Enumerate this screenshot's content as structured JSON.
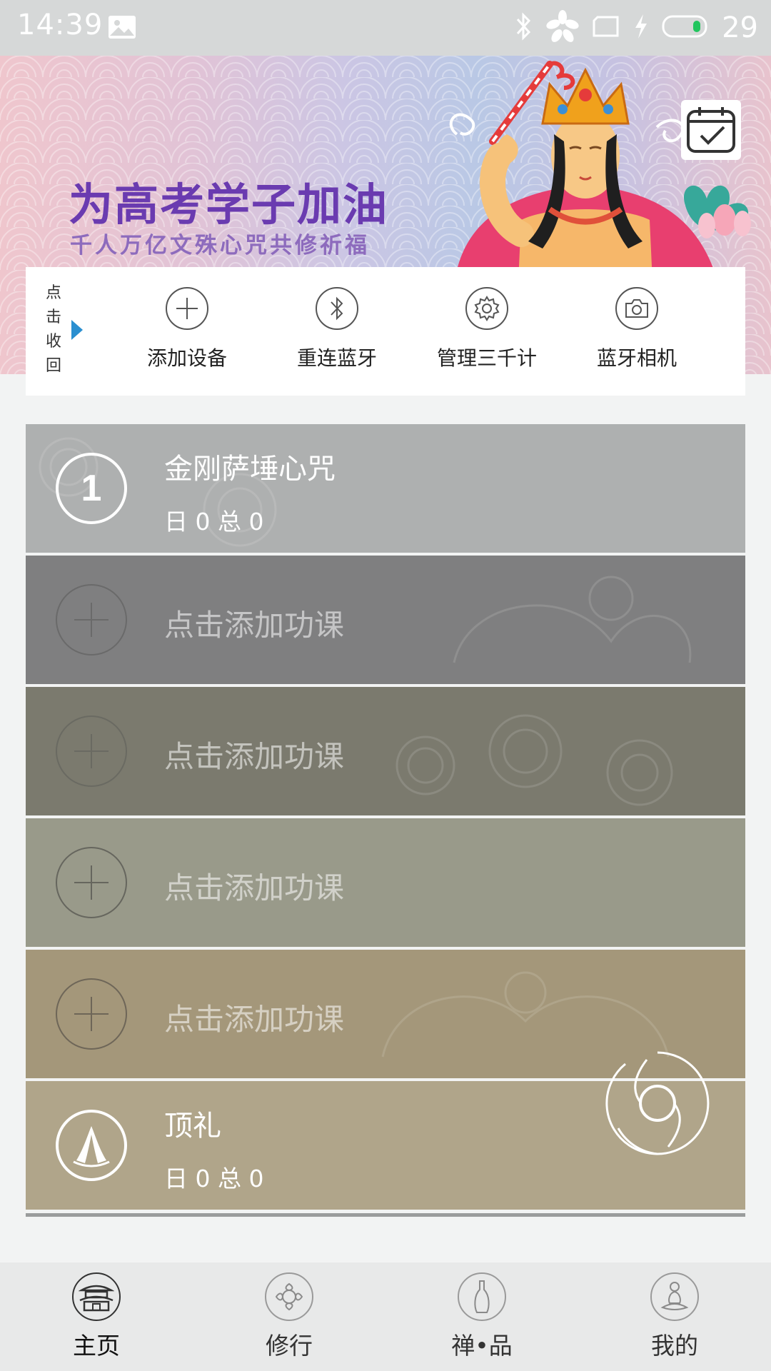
{
  "status_bar": {
    "time": "14:39",
    "battery_level": "29",
    "icons": [
      "image-icon",
      "bluetooth-icon",
      "flower-icon",
      "sim-icon",
      "charging-icon",
      "battery-icon"
    ]
  },
  "banner": {
    "title": "为高考学子加油",
    "subtitle": "千人万亿文殊心咒共修祈福",
    "calendar_icon": "calendar-check-icon"
  },
  "quick_actions": {
    "collapse_label": "点击收回",
    "items": [
      {
        "label": "添加设备",
        "icon": "plus-icon"
      },
      {
        "label": "重连蓝牙",
        "icon": "bluetooth-icon"
      },
      {
        "label": "管理三千计",
        "icon": "gear-icon"
      },
      {
        "label": "蓝牙相机",
        "icon": "camera-icon"
      }
    ]
  },
  "courses": [
    {
      "number": "1",
      "title": "金刚萨埵心咒",
      "stats": "日 0 总 0",
      "color": "#aeb0b0"
    },
    {
      "label": "点击添加功课",
      "color": "#7f7f80"
    },
    {
      "label": "点击添加功课",
      "color": "#7b7a6e"
    },
    {
      "label": "点击添加功课",
      "color": "#999a8a"
    },
    {
      "label": "点击添加功课",
      "color": "#a4977a"
    },
    {
      "title": "顶礼",
      "stats": "日 0 总 0",
      "color": "#b0a58a",
      "icon": "praying-hands-icon"
    }
  ],
  "bottom_nav": {
    "items": [
      {
        "label": "主页",
        "icon": "temple-icon",
        "active": true
      },
      {
        "label": "修行",
        "icon": "lotus-icon",
        "active": false
      },
      {
        "label": "禅•品",
        "icon": "vase-icon",
        "active": false
      },
      {
        "label": "我的",
        "icon": "meditation-icon",
        "active": false
      }
    ]
  }
}
